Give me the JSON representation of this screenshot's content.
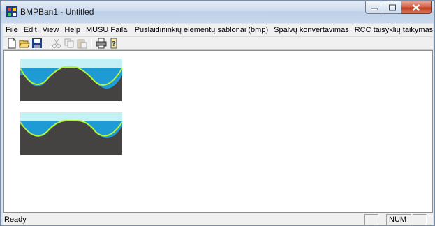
{
  "window": {
    "title": "BMPBan1 - Untitled"
  },
  "menu": [
    {
      "id": "file",
      "label": "File"
    },
    {
      "id": "edit",
      "label": "Edit"
    },
    {
      "id": "view",
      "label": "View"
    },
    {
      "id": "help",
      "label": "Help"
    },
    {
      "id": "musu-failai",
      "label": "MUSU Failai"
    },
    {
      "id": "templates",
      "label": "Puslaidininkių elementų sablonai (bmp)"
    },
    {
      "id": "color-convert",
      "label": "Spalvų konvertavimas"
    },
    {
      "id": "rcc-rules",
      "label": "RCC taisyklių taikymas"
    }
  ],
  "toolbar": {
    "buttons": [
      {
        "name": "new-icon"
      },
      {
        "name": "open-icon"
      },
      {
        "name": "save-icon"
      },
      {
        "name": "cut-icon",
        "disabled": true
      },
      {
        "name": "copy-icon",
        "disabled": true
      },
      {
        "name": "paste-icon",
        "disabled": true
      },
      {
        "name": "print-icon"
      },
      {
        "name": "about-icon"
      }
    ]
  },
  "images": [
    {
      "name": "waveform-bitmap-1",
      "profile": "flat-top"
    },
    {
      "name": "waveform-bitmap-2",
      "profile": "rounded-top"
    }
  ],
  "colors": {
    "bitmap_sky": "#c4f1f4",
    "bitmap_water": "#1e9bd5",
    "bitmap_ground": "#454242",
    "bitmap_outline": "#b6f23a"
  },
  "status": {
    "text": "Ready",
    "num": "NUM"
  }
}
